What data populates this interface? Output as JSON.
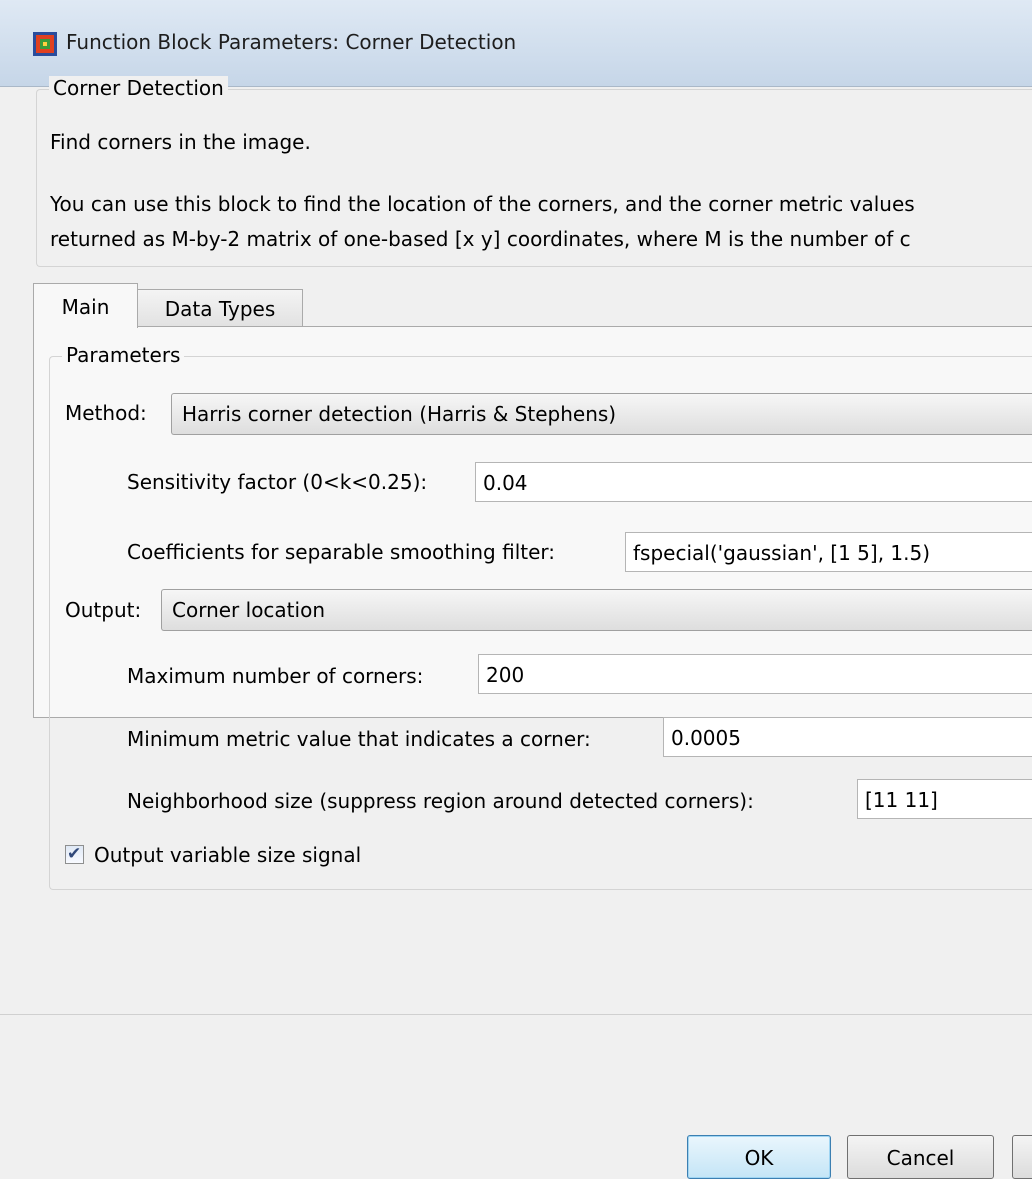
{
  "window": {
    "title": "Function Block Parameters: Corner Detection",
    "icon": "simulink-block-icon"
  },
  "description": {
    "legend": "Corner Detection",
    "line1": "Find corners in the image.",
    "line2": "You can use this block to find the location of the corners, and the corner metric values",
    "line3": "returned as M-by-2 matrix of one-based [x y] coordinates, where M is the number of c"
  },
  "tabs": [
    {
      "label": "Main",
      "selected": true
    },
    {
      "label": "Data Types",
      "selected": false
    }
  ],
  "parameters": {
    "legend": "Parameters",
    "method": {
      "label": "Method:",
      "value": "Harris corner detection (Harris & Stephens)"
    },
    "sensitivity": {
      "label": "Sensitivity factor (0<k<0.25):",
      "value": "0.04"
    },
    "coefficients": {
      "label": "Coefficients for separable smoothing filter:",
      "value": "fspecial('gaussian', [1 5], 1.5)"
    },
    "output": {
      "label": "Output:",
      "value": "Corner location"
    },
    "max_corners": {
      "label": "Maximum number of corners:",
      "value": "200"
    },
    "min_metric": {
      "label": "Minimum metric value that indicates a corner:",
      "value": "0.0005"
    },
    "neighborhood": {
      "label": "Neighborhood size (suppress region around detected corners):",
      "value": "[11 11]"
    },
    "variable_size": {
      "label": "Output variable size signal",
      "checked": true
    }
  },
  "buttons": {
    "ok": "OK",
    "cancel": "Cancel"
  },
  "colors": {
    "titlebar": "#c6d6e8",
    "default_button_border": "#3c7fb1"
  }
}
